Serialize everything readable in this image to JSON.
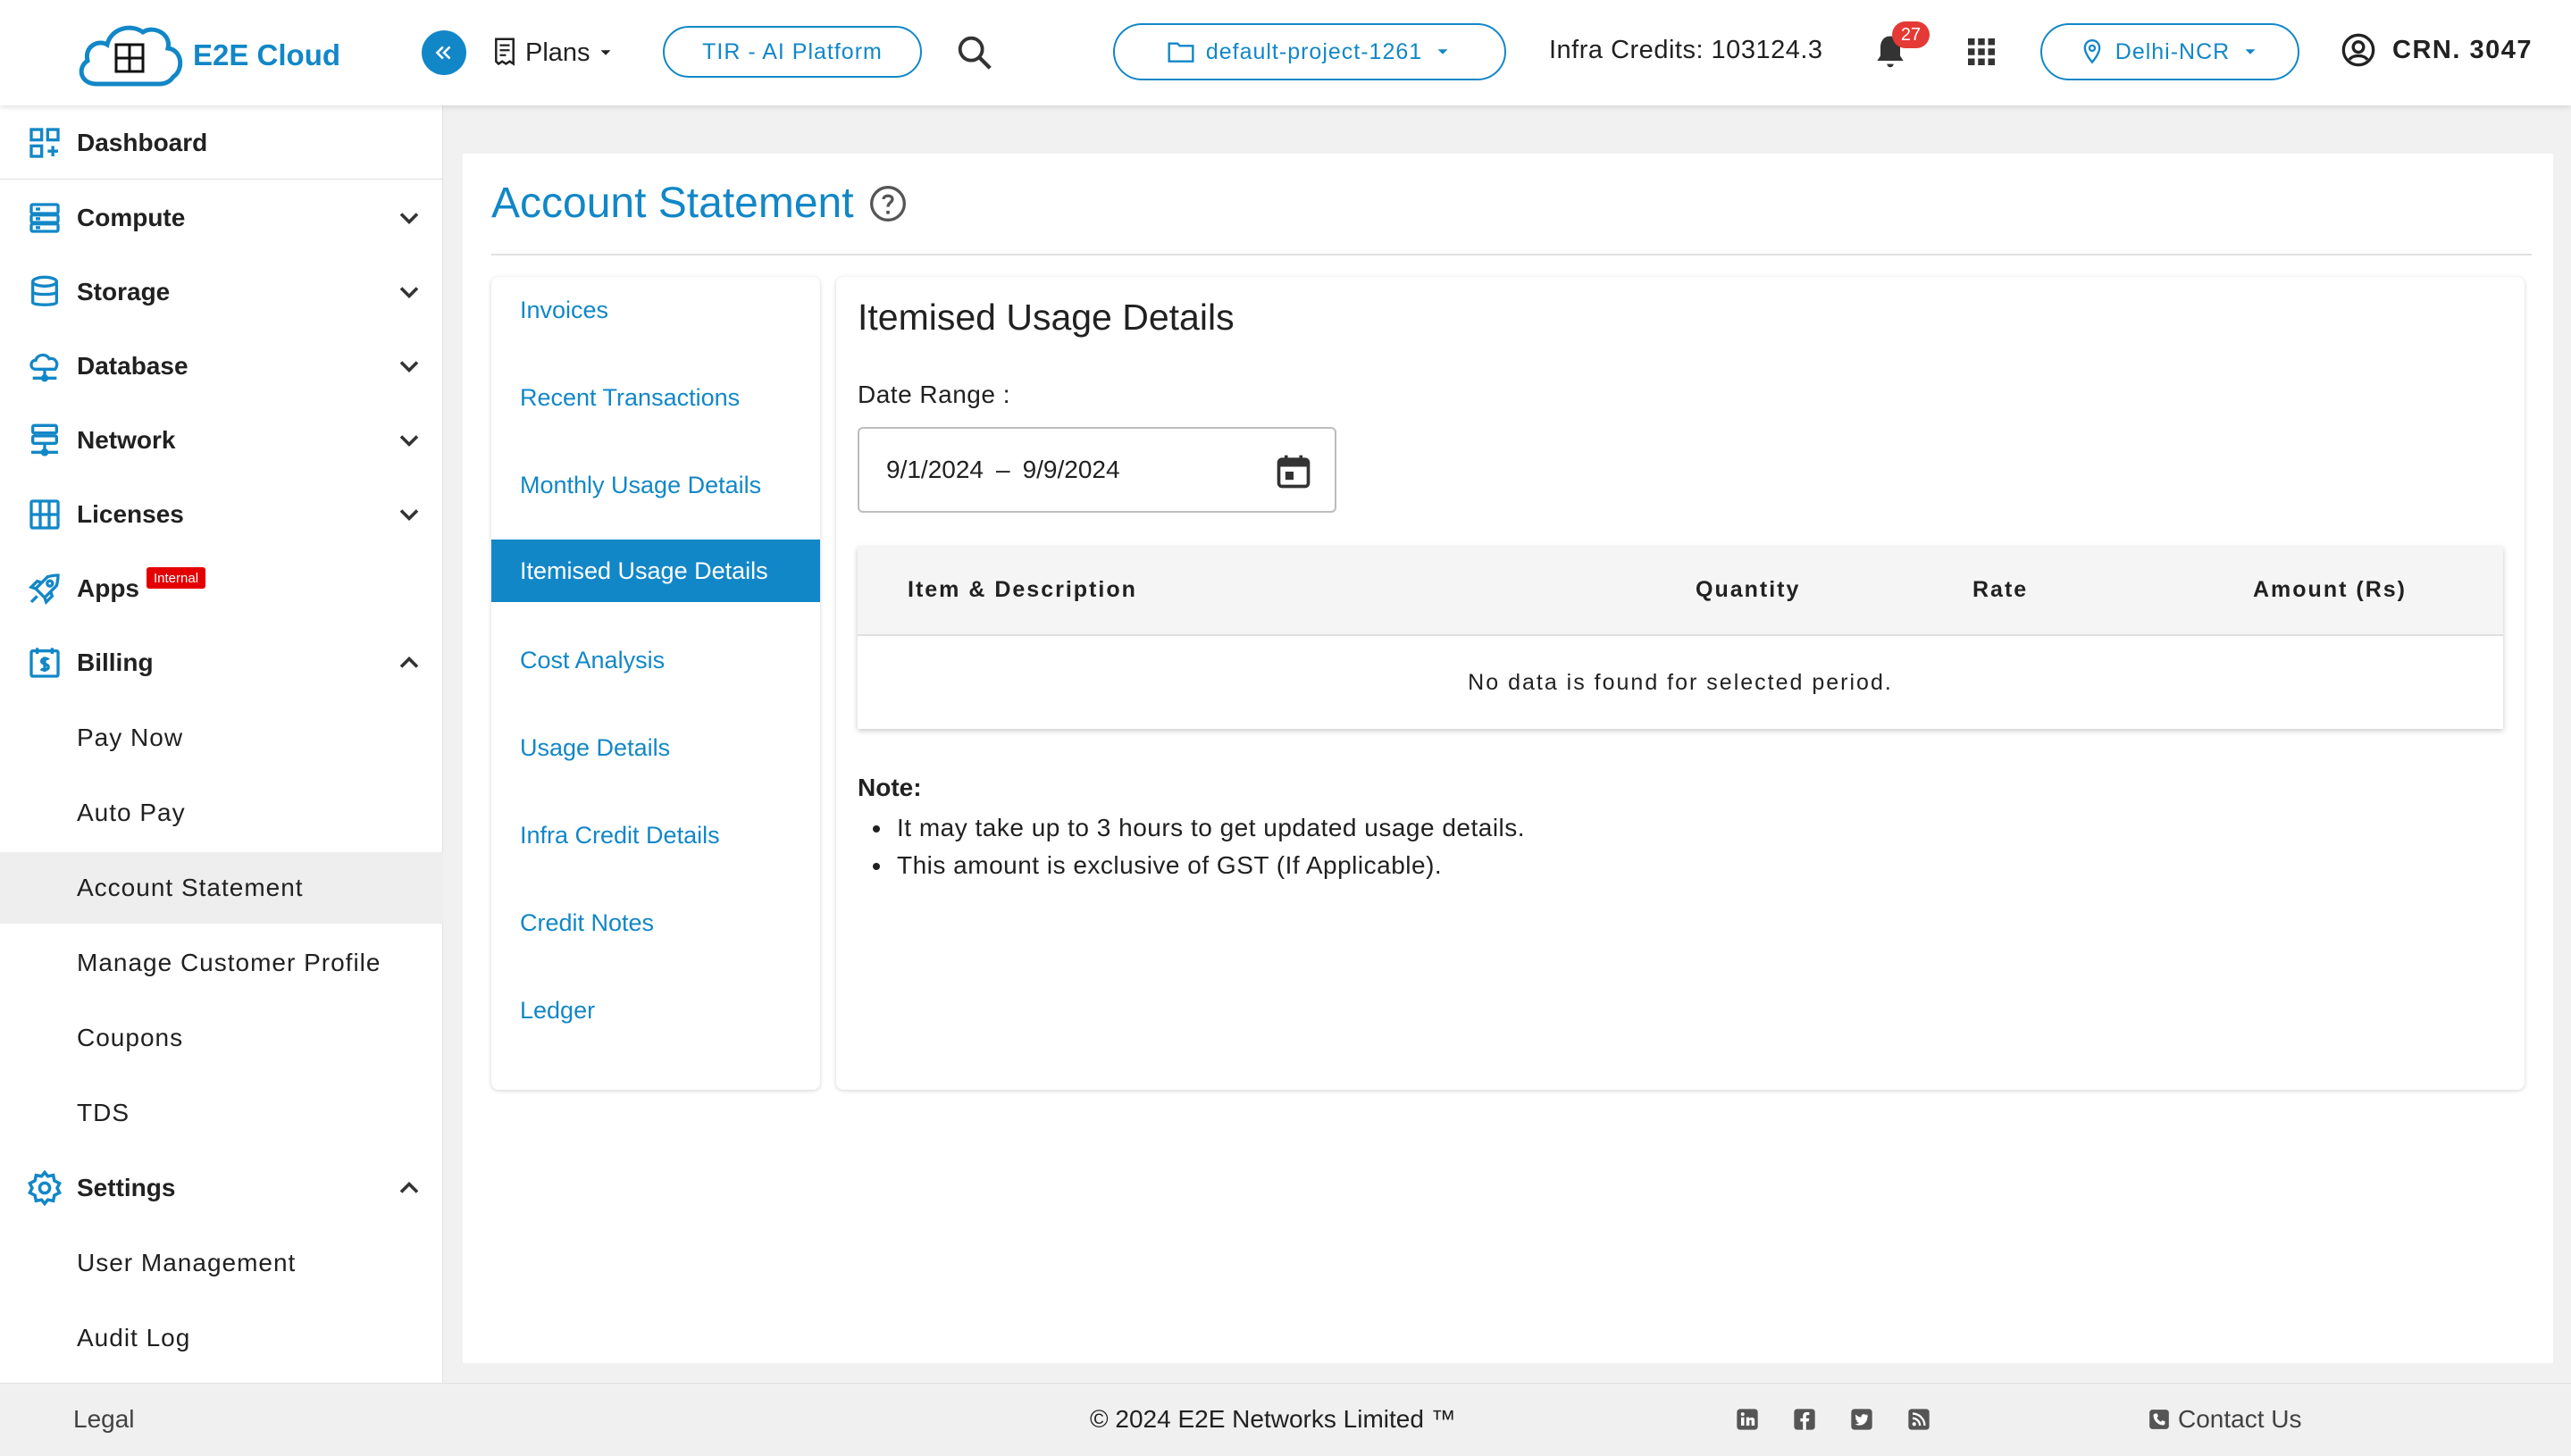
{
  "brand": {
    "name": "E2E Cloud",
    "logo_caption": "E2E Cloud",
    "accent": "#1287c7"
  },
  "header": {
    "plans_label": "Plans",
    "tir_label": "TIR - AI Platform",
    "project_label": "default-project-1261",
    "credits_label": "Infra Credits: 103124.3",
    "notification_count": "27",
    "region_label": "Delhi-NCR",
    "account_label": "CRN. 3047"
  },
  "sidebar": {
    "items": [
      {
        "label": "Dashboard",
        "icon": "dashboard-icon"
      },
      {
        "label": "Compute",
        "icon": "server-icon",
        "expanded": false
      },
      {
        "label": "Storage",
        "icon": "database-icon",
        "expanded": false
      },
      {
        "label": "Database",
        "icon": "cloud-database-icon",
        "expanded": false
      },
      {
        "label": "Network",
        "icon": "network-icon",
        "expanded": false
      },
      {
        "label": "Licenses",
        "icon": "license-icon",
        "expanded": false
      },
      {
        "label": "Apps",
        "icon": "rocket-icon",
        "badge": "Internal"
      },
      {
        "label": "Billing",
        "icon": "billing-icon",
        "expanded": true
      },
      {
        "label": "Settings",
        "icon": "gear-icon",
        "expanded": true
      }
    ],
    "billing_sub": [
      "Pay Now",
      "Auto Pay",
      "Account Statement",
      "Manage Customer Profile",
      "Coupons",
      "TDS"
    ],
    "settings_sub": [
      "User Management",
      "Audit Log"
    ],
    "active_item": "Account Statement"
  },
  "page": {
    "title": "Account Statement"
  },
  "submenu": {
    "items": [
      "Invoices",
      "Recent Transactions",
      "Monthly Usage Details",
      "Itemised Usage Details",
      "Cost Analysis",
      "Usage Details",
      "Infra Credit Details",
      "Credit Notes",
      "Ledger"
    ],
    "active": "Itemised Usage Details"
  },
  "content": {
    "title": "Itemised Usage Details",
    "date_range_label": "Date Range :",
    "date_start": "9/1/2024",
    "date_separator": "–",
    "date_end": "9/9/2024",
    "table": {
      "columns": [
        "Item & Description",
        "Quantity",
        "Rate",
        "Amount (Rs)"
      ],
      "empty_message": "No data is found for selected period."
    },
    "note_title": "Note:",
    "notes": [
      "It may take up to 3 hours to get updated usage details.",
      "This amount is exclusive of GST (If Applicable)."
    ]
  },
  "footer": {
    "legal": "Legal",
    "copyright": "© 2024 E2E Networks Limited ™",
    "social": [
      "linkedin-icon",
      "facebook-icon",
      "twitter-icon",
      "rss-icon"
    ],
    "contact": "Contact Us"
  }
}
